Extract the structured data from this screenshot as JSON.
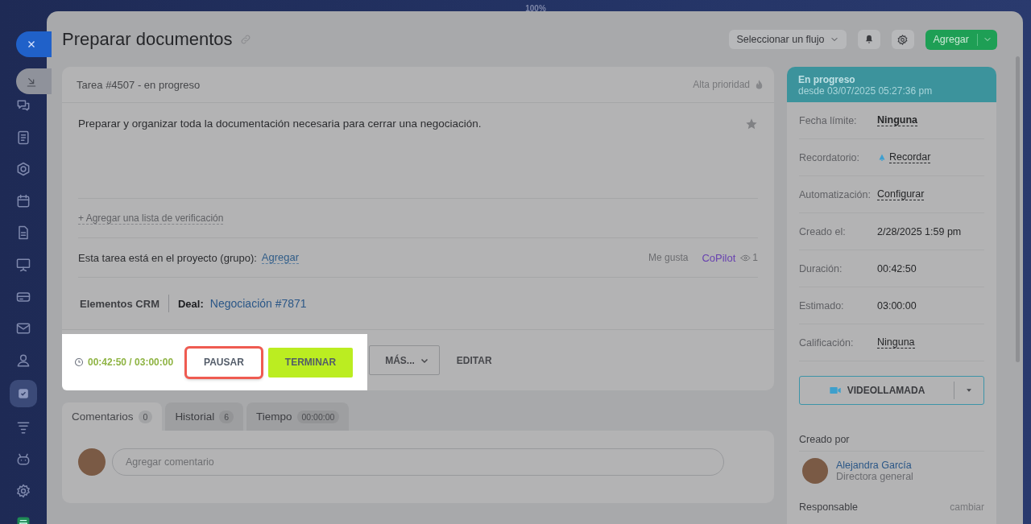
{
  "top_bar": {
    "zoom": "100%"
  },
  "sidebar": {
    "items": [
      {
        "kind": "chat",
        "selected": false
      },
      {
        "kind": "doc",
        "selected": false
      },
      {
        "kind": "hexagon",
        "selected": false
      },
      {
        "kind": "calendar",
        "selected": false
      },
      {
        "kind": "file",
        "selected": false
      },
      {
        "kind": "board",
        "selected": false
      },
      {
        "kind": "card",
        "selected": false
      },
      {
        "kind": "mail",
        "selected": false
      },
      {
        "kind": "people",
        "selected": false
      },
      {
        "kind": "check",
        "selected": true
      },
      {
        "kind": "filter",
        "selected": false
      },
      {
        "kind": "robot",
        "selected": false
      },
      {
        "kind": "gear",
        "selected": false
      },
      {
        "kind": "store",
        "selected": false
      }
    ]
  },
  "title": "Preparar documentos",
  "header_actions": {
    "flow_select": "Seleccionar un flujo",
    "add_button": "Agregar"
  },
  "task": {
    "heading": "Tarea #4507 - en progreso",
    "priority": "Alta prioridad",
    "description": "Preparar y organizar toda la documentación necesaria para cerrar una negociación.",
    "checklist_link": "+ Agregar una lista de verificación",
    "project_label": "Esta tarea está en el proyecto (grupo):",
    "project_link": "Agregar",
    "like": "Me gusta",
    "copilot": "CoPilot",
    "views": "1",
    "crm_label": "Elementos CRM",
    "deal_label": "Deal:",
    "deal_link": "Negociación #7871"
  },
  "spotlight": {
    "timer": "00:42:50 / 03:00:00",
    "buttons": [
      {
        "label": "PAUSAR",
        "kind": "outline",
        "highlighted": true
      },
      {
        "label": "TERMINAR",
        "kind": "primary",
        "highlighted": false
      }
    ]
  },
  "more_actions": [
    {
      "label": "MÁS...",
      "kind": "dropdown"
    },
    {
      "label": "EDITAR",
      "kind": "text"
    }
  ],
  "tabs": [
    {
      "label": "Comentarios",
      "count": "0",
      "selected": true
    },
    {
      "label": "Historial",
      "count": "6",
      "selected": false
    },
    {
      "label": "Tiempo",
      "count": "00:00:00",
      "selected": false
    }
  ],
  "comment": {
    "placeholder": "Agregar comentario"
  },
  "status": {
    "title": "En progreso",
    "since": "desde 03/07/2025 05:27:36 pm"
  },
  "fields": [
    {
      "label": "Fecha límite:",
      "value": "Ninguna",
      "kind": "link"
    },
    {
      "label": "Recordatorio:",
      "value": "Recordar",
      "kind": "bell"
    },
    {
      "label": "Automatización:",
      "value": "Configurar",
      "kind": "link"
    },
    {
      "label": "Creado el:",
      "value": "2/28/2025 1:59 pm",
      "kind": "text"
    },
    {
      "label": "Duración:",
      "value": "00:42:50",
      "kind": "text"
    },
    {
      "label": "Estimado:",
      "value": "03:00:00",
      "kind": "text"
    },
    {
      "label": "Calificación:",
      "value": "Ninguna",
      "kind": "link"
    }
  ],
  "video_button": "VIDEOLLAMADA",
  "created_by": {
    "heading": "Creado por",
    "name": "Alejandra García",
    "role": "Directora general"
  },
  "responsible": {
    "heading": "Responsable",
    "action": "cambiar"
  }
}
